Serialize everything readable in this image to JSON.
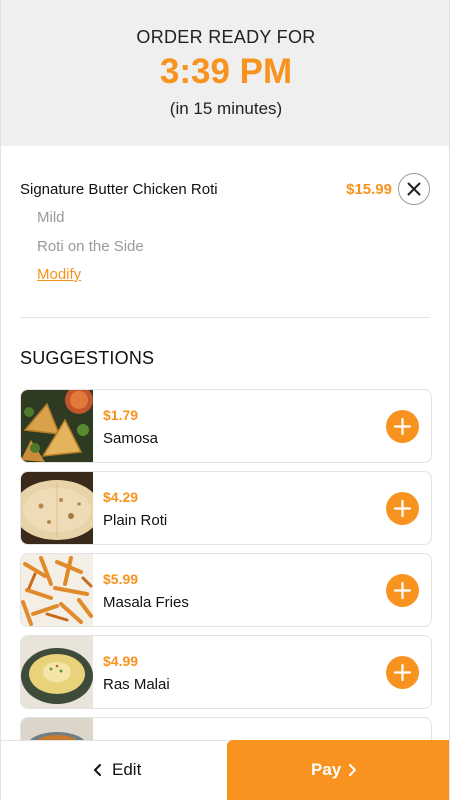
{
  "header": {
    "kicker": "ORDER READY FOR",
    "time": "3:39 PM",
    "sub": "(in 15 minutes)"
  },
  "order_item": {
    "name": "Signature Butter Chicken Roti",
    "price": "$15.99",
    "modifiers": [
      "Mild",
      "Roti on the Side"
    ],
    "modify_label": "Modify",
    "remove_icon": "close-icon"
  },
  "suggestions": {
    "title": "SUGGESTIONS",
    "items": [
      {
        "price": "$1.79",
        "name": "Samosa"
      },
      {
        "price": "$4.29",
        "name": "Plain Roti"
      },
      {
        "price": "$5.99",
        "name": "Masala Fries"
      },
      {
        "price": "$4.99",
        "name": "Ras Malai"
      }
    ],
    "add_icon": "plus-icon"
  },
  "footer": {
    "edit_label": "Edit",
    "pay_label": "Pay"
  },
  "colors": {
    "accent": "#f7931e",
    "header_bg": "#efefef",
    "muted_text": "#9a9a9a"
  }
}
